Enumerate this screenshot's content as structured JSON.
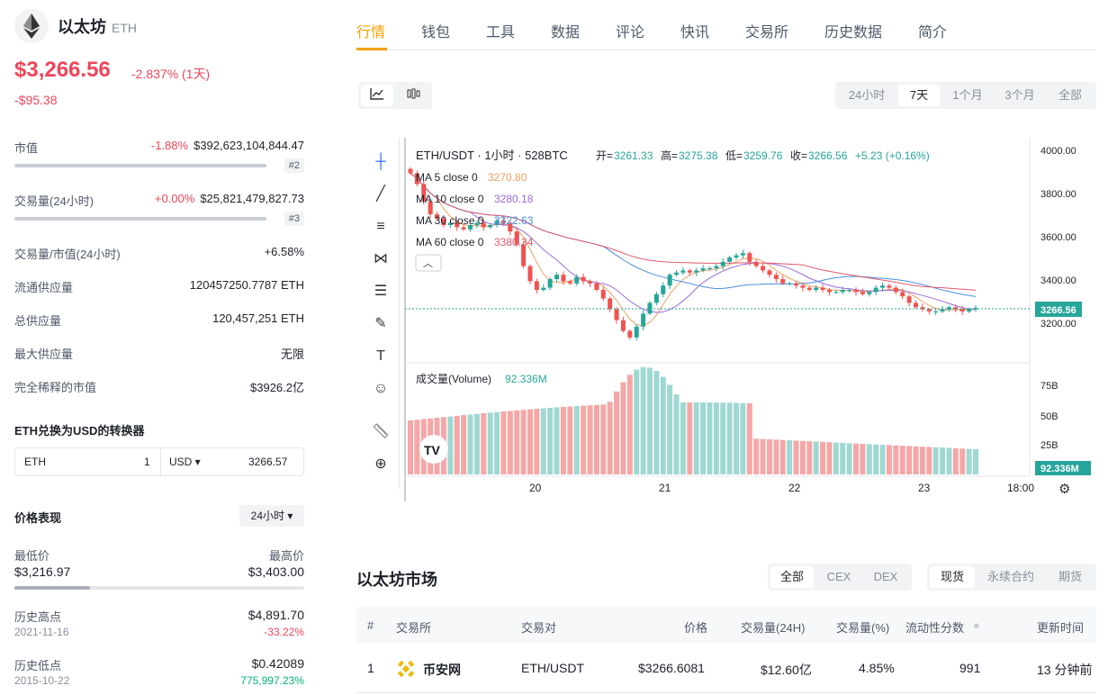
{
  "coin": {
    "name": "以太坊",
    "symbol": "ETH",
    "price": "$3,266.56",
    "change_pct": "-2.837% (1天)",
    "change_abs": "-$95.38"
  },
  "stats": {
    "market_cap": {
      "label": "市值",
      "pct": "-1.88%",
      "value": "$392,623,104,844.47",
      "rank": "#2"
    },
    "volume": {
      "label": "交易量(24小时)",
      "pct": "+0.00%",
      "value": "$25,821,479,827.73",
      "rank": "#3"
    },
    "vol_mcap": {
      "label": "交易量/市值(24小时)",
      "value": "+6.58%"
    },
    "circulating": {
      "label": "流通供应量",
      "value": "120457250.7787 ETH"
    },
    "total": {
      "label": "总供应量",
      "value": "120,457,251 ETH"
    },
    "max": {
      "label": "最大供应量",
      "value": "无限"
    },
    "fdv": {
      "label": "完全稀释的市值",
      "value": "$3926.2亿"
    }
  },
  "converter": {
    "title": "ETH兑换为USD的转换器",
    "from_symbol": "ETH",
    "from_amount": "1",
    "to_symbol": "USD ▾",
    "to_amount": "3266.57"
  },
  "performance": {
    "title": "价格表现",
    "period": "24小时 ▾",
    "low_label": "最低价",
    "low_value": "$3,216.97",
    "high_label": "最高价",
    "high_value": "$3,403.00",
    "range_fraction": 0.26,
    "ath_label": "历史高点",
    "ath_value": "$4,891.70",
    "ath_date": "2021-11-16",
    "ath_pct": "-33.22%",
    "atl_label": "历史低点",
    "atl_value": "$0.42089",
    "atl_date": "2015-10-22",
    "atl_pct": "775,997.23%"
  },
  "nav": [
    "行情",
    "钱包",
    "工具",
    "数据",
    "评论",
    "快讯",
    "交易所",
    "历史数据",
    "简介"
  ],
  "chart_view": {
    "line_icon": "line-chart-icon",
    "candle_icon": "candlestick-icon"
  },
  "ranges": [
    "24小时",
    "7天",
    "1个月",
    "3个月",
    "全部"
  ],
  "chart": {
    "pair_line": "ETH/USDT · 1小时 · 528BTC",
    "open_label": "开=",
    "open_value": "3261.33",
    "high_label": "高=",
    "high_value": "3275.38",
    "low_label": "低=",
    "low_value": "3259.76",
    "close_label": "收=",
    "close_value": "3266.56",
    "change": "+5.23 (+0.16%)",
    "ma5_label": "MA 5 close 0",
    "ma5_value": "3270.80",
    "ma10_label": "MA 10 close 0",
    "ma10_value": "3280.18",
    "ma30_label": "MA 30 close 0",
    "ma30_value": "3322.63",
    "ma60_label": "MA 60 close 0",
    "ma60_value": "3380.34",
    "price_ticks": [
      "4000.00",
      "3800.00",
      "3600.00",
      "3400.00",
      "3200.00"
    ],
    "current_tag": "3266.56",
    "volume_label": "成交量(Volume)",
    "volume_value": "92.336M",
    "volume_ticks": [
      "75B",
      "50B",
      "25B"
    ],
    "volume_tag": "92.336M",
    "x_ticks": [
      "20",
      "21",
      "22",
      "23",
      "18:00"
    ],
    "colors": {
      "up": "#26a69a",
      "down": "#ef5350",
      "ma5": "#f0a060",
      "ma10": "#9c6ade",
      "ma30": "#4a90e2",
      "ma60": "#e05a6b"
    }
  },
  "chart_data": {
    "type": "candlestick",
    "title": "ETH/USDT · 1小时 · 528BTC",
    "ylim": [
      3100,
      4050
    ],
    "y_ticks": [
      4000,
      3800,
      3600,
      3400,
      3200
    ],
    "x_ticks": [
      "20",
      "21",
      "22",
      "23",
      "18:00"
    ],
    "close": [
      3890,
      3840,
      3760,
      3700,
      3680,
      3650,
      3660,
      3640,
      3630,
      3650,
      3660,
      3640,
      3650,
      3670,
      3660,
      3620,
      3560,
      3460,
      3390,
      3350,
      3360,
      3400,
      3420,
      3390,
      3380,
      3410,
      3390,
      3380,
      3350,
      3310,
      3260,
      3210,
      3160,
      3130,
      3180,
      3240,
      3290,
      3330,
      3370,
      3420,
      3430,
      3440,
      3430,
      3440,
      3450,
      3450,
      3460,
      3480,
      3500,
      3510,
      3520,
      3480,
      3460,
      3440,
      3420,
      3400,
      3380,
      3380,
      3370,
      3360,
      3350,
      3360,
      3350,
      3340,
      3340,
      3350,
      3350,
      3340,
      3330,
      3340,
      3360,
      3370,
      3360,
      3340,
      3320,
      3290,
      3270,
      3260,
      3250,
      3250,
      3260,
      3270,
      3260,
      3250,
      3260,
      3266.56
    ],
    "volume_label": "成交量(Volume)",
    "volume_last": "92.336M"
  },
  "market": {
    "title": "以太坊市场",
    "filters": [
      "全部",
      "CEX",
      "DEX"
    ],
    "types": [
      "现货",
      "永续合约",
      "期货"
    ],
    "headers": [
      "#",
      "交易所",
      "交易对",
      "价格",
      "交易量(24H)",
      "交易量(%)",
      "流动性分数",
      "更新时间"
    ],
    "rows": [
      {
        "rank": "1",
        "exchange": "币安网",
        "pair": "ETH/USDT",
        "price": "$3266.6081",
        "volume": "$12.60亿",
        "volume_pct": "4.85%",
        "liquidity": "991",
        "updated": "13 分钟前"
      }
    ]
  }
}
